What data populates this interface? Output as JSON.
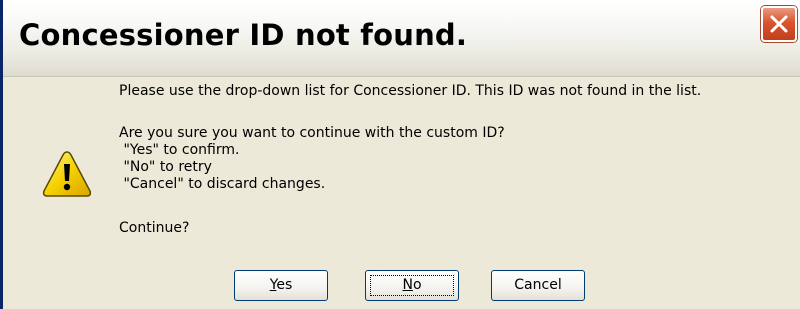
{
  "window": {
    "title": "Concessioner ID not found."
  },
  "icons": {
    "warning": "warning-icon",
    "close": "close-icon"
  },
  "message": {
    "line1": "Please use the drop-down list for Concessioner ID. This ID was not found in the list.",
    "line2": "Are you sure you want to continue with the custom ID?",
    "line3": " \"Yes\" to confirm.",
    "line4": " \"No\" to retry",
    "line5": " \"Cancel\" to discard changes.",
    "line6": "Continue?"
  },
  "buttons": {
    "yes_mnemonic": "Y",
    "yes_rest": "es",
    "no_mnemonic": "N",
    "no_rest": "o",
    "cancel": "Cancel"
  },
  "colors": {
    "dialog_background": "#ece9d8",
    "close_button": "#d9542f",
    "warning_yellow": "#f5d000",
    "button_border": "#003c74"
  }
}
